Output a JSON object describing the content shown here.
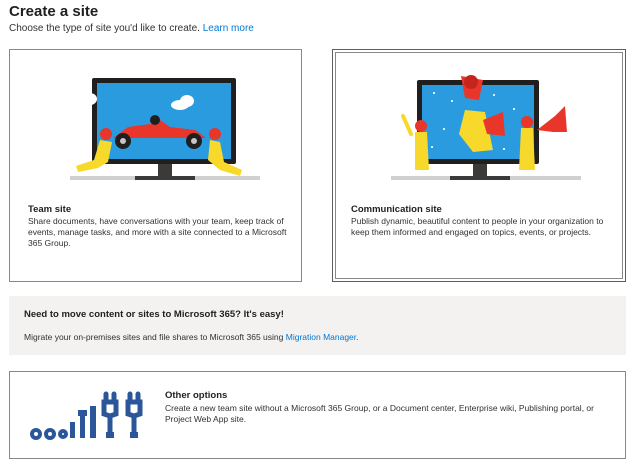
{
  "header": {
    "title": "Create a site",
    "subtitle": "Choose the type of site you'd like to create.",
    "learn_more": "Learn more"
  },
  "cards": {
    "team": {
      "title": "Team site",
      "description": "Share documents, have conversations with your team, keep track of events, manage tasks, and more with a site connected to a Microsoft 365 Group."
    },
    "communication": {
      "title": "Communication site",
      "description": "Publish dynamic, beautiful content to people in your organization to keep them informed and engaged on topics, events, or projects."
    }
  },
  "migration": {
    "title": "Need to move content or sites to Microsoft 365? It's easy!",
    "text": "Migrate your on-premises sites and file shares to Microsoft 365 using",
    "link": "Migration Manager",
    "end": "."
  },
  "other": {
    "title": "Other options",
    "description": "Create a new team site without a Microsoft 365 Group, or a Document center, Enterprise wiki, Publishing portal, or Project Web App site."
  },
  "colors": {
    "accent": "#0078d4",
    "screen_blue": "#1e8fd9",
    "figure_yellow": "#f7d92b",
    "race_red": "#e8362a",
    "tools_blue": "#2b579a"
  }
}
